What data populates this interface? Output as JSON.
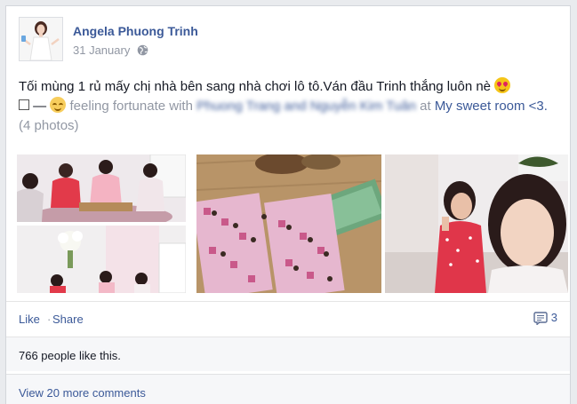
{
  "post": {
    "author": "Angela Phuong Trinh",
    "date": "31 January",
    "privacy_icon": "globe-icon",
    "text_main": "Tối mùng 1 rủ mấy chị nhà bên sang nhà chơi lô tô.Ván đầu Trinh thắng luôn nè",
    "emoji1": "smiling-face-heart-eyes",
    "dash": "—",
    "emoji2": "relieved-face",
    "feeling": "feeling fortunate with",
    "tagged": "Phuong Trang and Nguyễn Kim Tuân",
    "at": "at",
    "place": "My sweet room <3.",
    "photos_count": "(4 photos)"
  },
  "actions": {
    "like": "Like",
    "separator": "·",
    "share": "Share",
    "comment_count": "3"
  },
  "likes": {
    "text": "766 people like this."
  },
  "comments": {
    "view_more": "View 20 more comments"
  },
  "colors": {
    "link": "#3b5998",
    "muted": "#9197a3",
    "text": "#141823"
  }
}
